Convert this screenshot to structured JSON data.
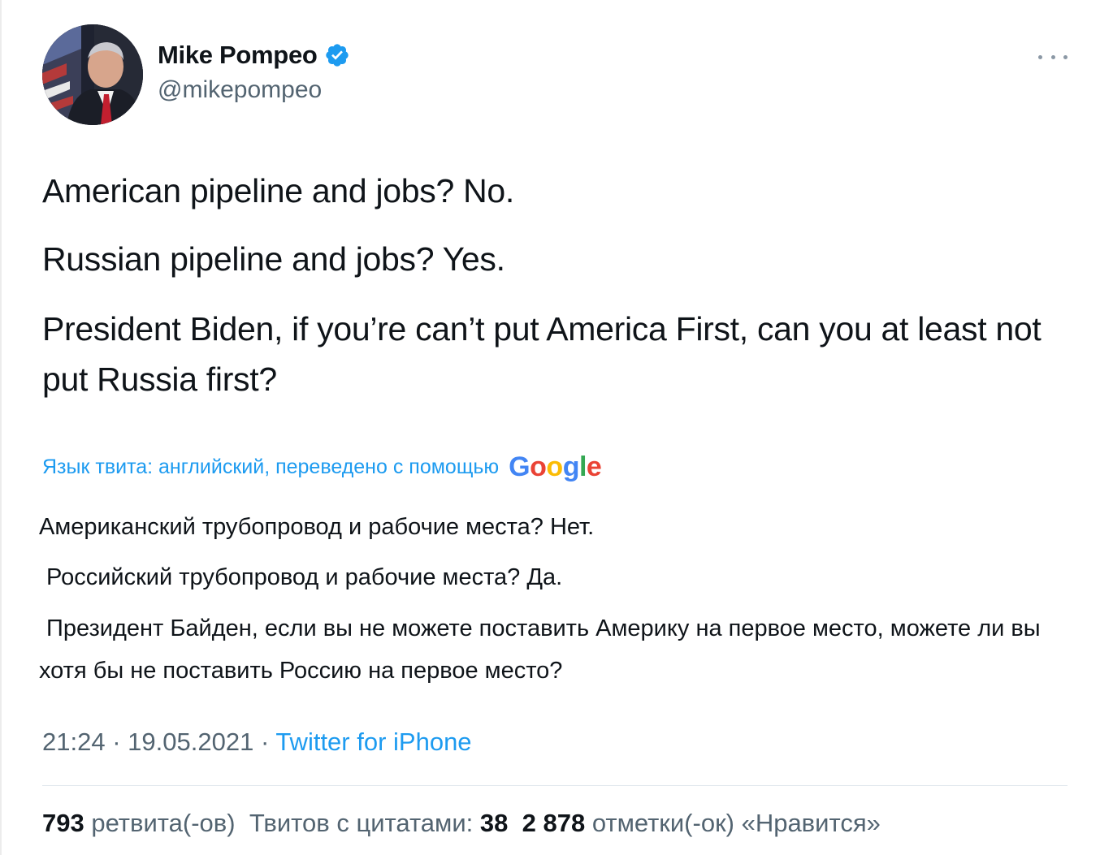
{
  "author": {
    "display_name": "Mike Pompeo",
    "handle": "@mikepompeo",
    "verified": true
  },
  "tweet": {
    "lines": [
      "American pipeline and jobs? No.",
      "Russian pipeline and jobs? Yes.",
      "President Biden, if you’re can’t put America First, can you at least not put Russia first?"
    ]
  },
  "translation": {
    "label": "Язык твита: английский, переведено с помощью",
    "provider": "Google",
    "lines": [
      "Американский трубопровод и рабочие места? Нет.",
      "Российский трубопровод и рабочие места? Да.",
      "Президент Байден, если вы не можете поставить Америку на первое место, можете ли вы хотя бы не поставить Россию на первое место?"
    ]
  },
  "meta": {
    "time": "21:24",
    "date": "19.05.2021",
    "separator": "·",
    "source": "Twitter for iPhone"
  },
  "stats": {
    "retweets_count": "793",
    "retweets_label": "ретвита(-ов)",
    "quotes_label": "Твитов с цитатами:",
    "quotes_count": "38",
    "likes_count": "2 878",
    "likes_label": "отметки(-ок) «Нравится»"
  },
  "colors": {
    "link": "#1d9bf0",
    "secondary_text": "#536471",
    "verified_badge": "#1d9bf0"
  },
  "icons": {
    "verified": "verified-badge-icon",
    "more": "more-options-icon"
  }
}
